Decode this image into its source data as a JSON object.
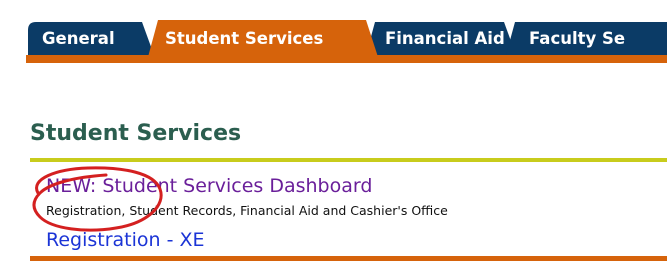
{
  "tabs": [
    {
      "label": "General"
    },
    {
      "label": "Student Services"
    },
    {
      "label": "Financial Aid"
    },
    {
      "label": "Faculty Se"
    }
  ],
  "section": {
    "title": "Student Services"
  },
  "links": {
    "dashboard": "NEW: Student Services Dashboard",
    "dashboard_description": "Registration, Student Records, Financial Aid and Cashier's Office",
    "registration": "Registration - XE"
  },
  "colors": {
    "tab_active": "#d6630b",
    "tab_inactive": "#0b3b66",
    "title": "#2b5e4f",
    "title_rule": "#c8cc1c",
    "visited_link": "#6a1f9a",
    "link": "#1b34d6",
    "annotation_circle": "#d42020"
  }
}
